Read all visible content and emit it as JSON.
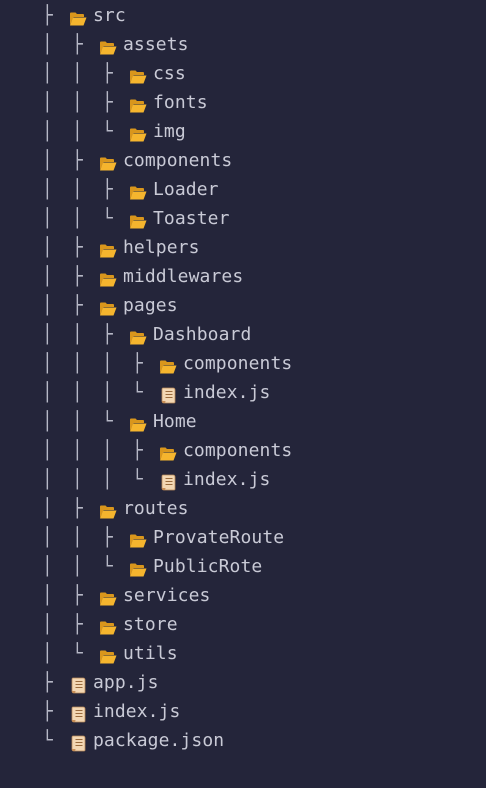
{
  "tree": {
    "items": [
      {
        "depth": 0,
        "prefix": [
          "├"
        ],
        "type": "folder",
        "name": "src"
      },
      {
        "depth": 1,
        "prefix": [
          "│",
          "├"
        ],
        "type": "folder",
        "name": "assets"
      },
      {
        "depth": 2,
        "prefix": [
          "│",
          "│",
          "├"
        ],
        "type": "folder",
        "name": "css"
      },
      {
        "depth": 2,
        "prefix": [
          "│",
          "│",
          "├"
        ],
        "type": "folder",
        "name": "fonts"
      },
      {
        "depth": 2,
        "prefix": [
          "│",
          "│",
          "└"
        ],
        "type": "folder",
        "name": "img"
      },
      {
        "depth": 1,
        "prefix": [
          "│",
          "├"
        ],
        "type": "folder",
        "name": "components"
      },
      {
        "depth": 2,
        "prefix": [
          "│",
          "│",
          "├"
        ],
        "type": "folder",
        "name": "Loader"
      },
      {
        "depth": 2,
        "prefix": [
          "│",
          "│",
          "└"
        ],
        "type": "folder",
        "name": "Toaster"
      },
      {
        "depth": 1,
        "prefix": [
          "│",
          "├"
        ],
        "type": "folder",
        "name": "helpers"
      },
      {
        "depth": 1,
        "prefix": [
          "│",
          "├"
        ],
        "type": "folder",
        "name": "middlewares"
      },
      {
        "depth": 1,
        "prefix": [
          "│",
          "├"
        ],
        "type": "folder",
        "name": "pages"
      },
      {
        "depth": 2,
        "prefix": [
          "│",
          "│",
          "├"
        ],
        "type": "folder",
        "name": "Dashboard"
      },
      {
        "depth": 3,
        "prefix": [
          "│",
          "│",
          "│",
          "├"
        ],
        "type": "folder",
        "name": "components"
      },
      {
        "depth": 3,
        "prefix": [
          "│",
          "│",
          "│",
          "└"
        ],
        "type": "file",
        "name": "index.js"
      },
      {
        "depth": 2,
        "prefix": [
          "│",
          "│",
          "└"
        ],
        "type": "folder",
        "name": "Home"
      },
      {
        "depth": 3,
        "prefix": [
          "│",
          "│",
          "│",
          "├"
        ],
        "type": "folder",
        "name": "components"
      },
      {
        "depth": 3,
        "prefix": [
          "│",
          "│",
          "│",
          "└"
        ],
        "type": "file",
        "name": "index.js"
      },
      {
        "depth": 1,
        "prefix": [
          "│",
          "├"
        ],
        "type": "folder",
        "name": "routes"
      },
      {
        "depth": 2,
        "prefix": [
          "│",
          "│",
          "├"
        ],
        "type": "folder",
        "name": "ProvateRoute"
      },
      {
        "depth": 2,
        "prefix": [
          "│",
          "│",
          "└"
        ],
        "type": "folder",
        "name": "PublicRote"
      },
      {
        "depth": 1,
        "prefix": [
          "│",
          "├"
        ],
        "type": "folder",
        "name": "services"
      },
      {
        "depth": 1,
        "prefix": [
          "│",
          "├"
        ],
        "type": "folder",
        "name": "store"
      },
      {
        "depth": 1,
        "prefix": [
          "│",
          "└"
        ],
        "type": "folder",
        "name": "utils"
      },
      {
        "depth": 0,
        "prefix": [
          "├"
        ],
        "type": "file",
        "name": "app.js"
      },
      {
        "depth": 0,
        "prefix": [
          "├"
        ],
        "type": "file",
        "name": "index.js"
      },
      {
        "depth": 0,
        "prefix": [
          "└"
        ],
        "type": "file",
        "name": "package.json"
      }
    ]
  },
  "icons": {
    "folder": "open-folder-icon",
    "file": "page-with-curl-icon"
  },
  "colors": {
    "background": "#24253a",
    "text": "#c9cad6",
    "guide": "#b6b8c6",
    "folder": "#f5b52e",
    "file": "#f3d7b3"
  }
}
